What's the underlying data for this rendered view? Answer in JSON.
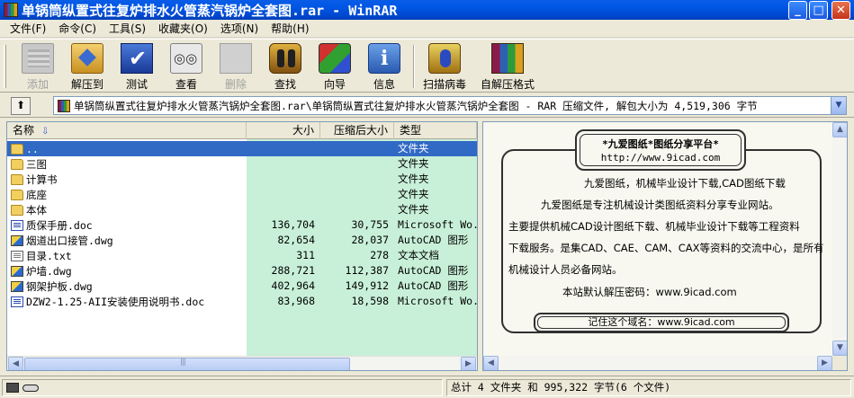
{
  "window": {
    "title": "单锅筒纵置式往复炉排水火管蒸汽锅炉全套图.rar - WinRAR",
    "minimize": "_",
    "maximize": "□",
    "close": "✕"
  },
  "menu": [
    "文件(F)",
    "命令(C)",
    "工具(S)",
    "收藏夹(O)",
    "选项(N)",
    "帮助(H)"
  ],
  "toolbar": [
    {
      "label": "添加",
      "icon": "add-archive-icon",
      "enabled": false
    },
    {
      "label": "解压到",
      "icon": "extract-to-icon",
      "enabled": true
    },
    {
      "label": "测试",
      "icon": "test-check-icon",
      "enabled": true
    },
    {
      "label": "查看",
      "icon": "view-glasses-icon",
      "enabled": true
    },
    {
      "label": "删除",
      "icon": "delete-icon",
      "enabled": false
    },
    {
      "label": "查找",
      "icon": "find-binoculars-icon",
      "enabled": true
    },
    {
      "label": "向导",
      "icon": "wizard-icon",
      "enabled": true
    },
    {
      "label": "信息",
      "icon": "info-icon",
      "enabled": true
    },
    {
      "label": "扫描病毒",
      "icon": "virus-scan-icon",
      "enabled": true
    },
    {
      "label": "自解压格式",
      "icon": "sfx-archive-icon",
      "enabled": true
    }
  ],
  "address": {
    "up": "⬆",
    "path": "单锅筒纵置式往复炉排水火管蒸汽锅炉全套图.rar\\单锅筒纵置式往复炉排水火管蒸汽锅炉全套图 - RAR 压缩文件, 解包大小为 4,519,306 字节",
    "dropdown": "▼"
  },
  "columns": {
    "name": "名称",
    "size": "大小",
    "packed": "压缩后大小",
    "type": "类型",
    "sort_arrow": "⇩"
  },
  "files": [
    {
      "name": "..",
      "size": "",
      "packed": "",
      "type": "文件夹",
      "icon": "folder-icon",
      "selected": true
    },
    {
      "name": "三图",
      "size": "",
      "packed": "",
      "type": "文件夹",
      "icon": "folder-icon"
    },
    {
      "name": "计算书",
      "size": "",
      "packed": "",
      "type": "文件夹",
      "icon": "folder-icon"
    },
    {
      "name": "底座",
      "size": "",
      "packed": "",
      "type": "文件夹",
      "icon": "folder-icon"
    },
    {
      "name": "本体",
      "size": "",
      "packed": "",
      "type": "文件夹",
      "icon": "folder-icon"
    },
    {
      "name": "质保手册.doc",
      "size": "136,704",
      "packed": "30,755",
      "type": "Microsoft Wo...",
      "icon": "word-doc-icon"
    },
    {
      "name": "烟道出口接管.dwg",
      "size": "82,654",
      "packed": "28,037",
      "type": "AutoCAD 图形",
      "icon": "autocad-dwg-icon"
    },
    {
      "name": "目录.txt",
      "size": "311",
      "packed": "278",
      "type": "文本文档",
      "icon": "text-file-icon"
    },
    {
      "name": "炉墙.dwg",
      "size": "288,721",
      "packed": "112,387",
      "type": "AutoCAD 图形",
      "icon": "autocad-dwg-icon"
    },
    {
      "name": "钢架护板.dwg",
      "size": "402,964",
      "packed": "149,912",
      "type": "AutoCAD 图形",
      "icon": "autocad-dwg-icon"
    },
    {
      "name": "DZW2-1.25-AII安装使用说明书.doc",
      "size": "83,968",
      "packed": "18,598",
      "type": "Microsoft Wo...",
      "icon": "word-doc-icon"
    }
  ],
  "scroll": {
    "left": "◀",
    "right": "▶",
    "up": "▲",
    "down": "▼"
  },
  "comment": {
    "header_title": "*九爱图纸*图纸分享平台*",
    "header_url": "http://www.9icad.com",
    "lines": [
      "九爱图纸，机械毕业设计下载,CAD图纸下载",
      "九爱图纸是专注机械设计类图纸资料分享专业网站。",
      "主要提供机械CAD设计图纸下载、机械毕业设计下载等工程资料",
      "下载服务。是集CAD、CAE、CAM、CAX等资料的交流中心，是所有",
      "机械设计人员必备网站。",
      "本站默认解压密码：www.9icad.com"
    ],
    "footer": "记住这个域名：www.9icad.com"
  },
  "status": {
    "summary": "总计 4 文件夹 和 995,322 字节(6 个文件)"
  }
}
